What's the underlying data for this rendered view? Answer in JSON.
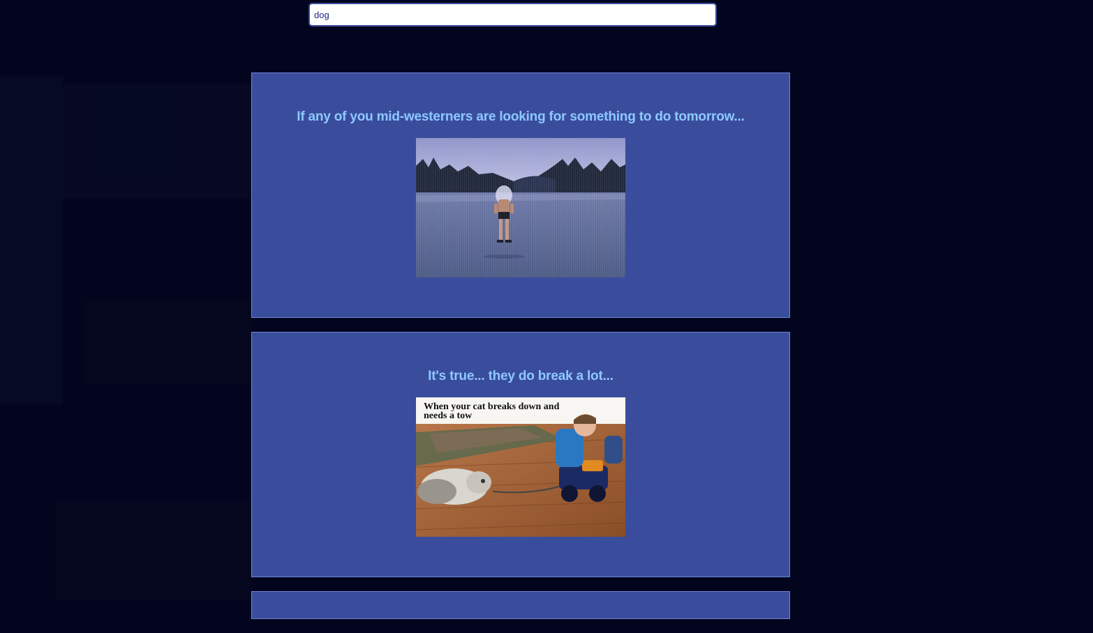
{
  "search": {
    "value": "dog",
    "placeholder": ""
  },
  "posts": [
    {
      "title": "If any of you mid-westerners are looking for something to do tomorrow...",
      "image_icon": "frozen-lake-skater-image"
    },
    {
      "title": "It's true... they do break a lot...",
      "image_icon": "cat-tow-truck-image",
      "image_caption": "When your cat breaks down and needs a tow"
    }
  ],
  "colors": {
    "background": "#03051f",
    "card": "#3a4d9c",
    "card_border": "#6e86d6",
    "title": "#8ec8ff"
  }
}
